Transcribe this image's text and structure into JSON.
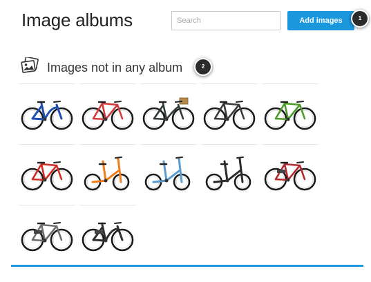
{
  "header": {
    "title": "Image albums",
    "search_placeholder": "Search",
    "add_button_label": "Add images"
  },
  "badges": {
    "first": "1",
    "second": "2"
  },
  "section": {
    "title": "Images not in any album",
    "icon": "photos-icon"
  },
  "images": [
    {
      "frame": "#1e4fb3",
      "style": "cruiser"
    },
    {
      "frame": "#d23a3a",
      "style": "road"
    },
    {
      "frame": "#2f3a33",
      "style": "basket"
    },
    {
      "frame": "#3a3a3a",
      "style": "mtb"
    },
    {
      "frame": "#4c9a2a",
      "style": "mtb-full"
    },
    {
      "frame": "#d22b22",
      "style": "mtb"
    },
    {
      "frame": "#f07d1a",
      "style": "folding"
    },
    {
      "frame": "#5a9bd0",
      "style": "folding"
    },
    {
      "frame": "#2b2b2b",
      "style": "folding"
    },
    {
      "frame": "#b2282b",
      "style": "ebike"
    },
    {
      "frame": "#6d6d6d",
      "style": "ebike"
    },
    {
      "frame": "#2e2e2e",
      "style": "cruiser-ebike"
    }
  ],
  "colors": {
    "accent": "#1a97dd",
    "badge": "#2b2b2b"
  }
}
